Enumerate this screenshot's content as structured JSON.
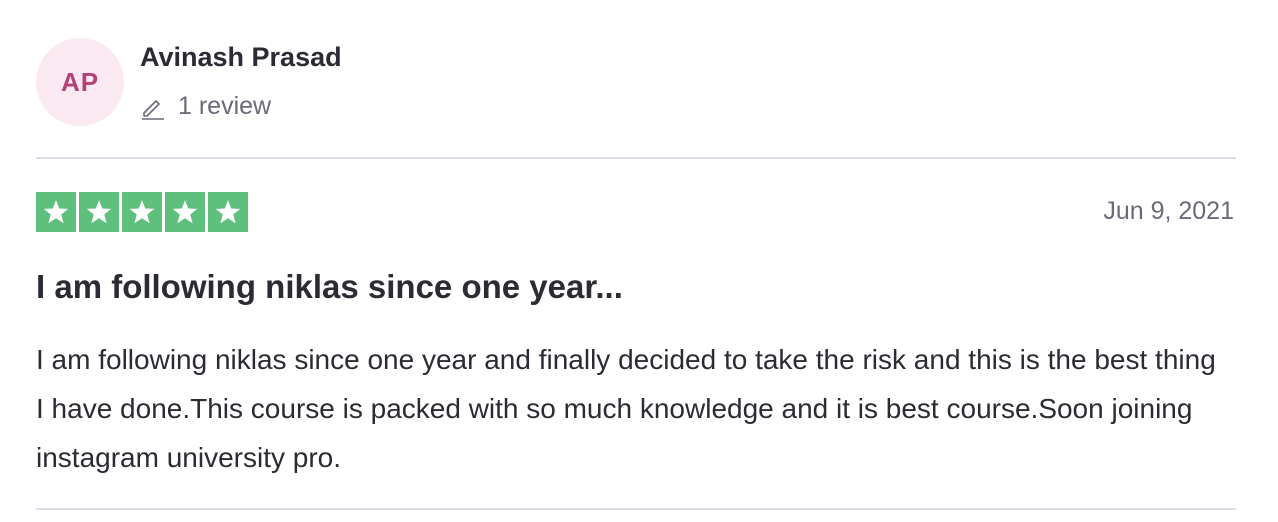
{
  "reviewer": {
    "initials": "AP",
    "name": "Avinash Prasad",
    "review_count": "1 review",
    "avatar_bg": "#fbe9f1",
    "avatar_fg": "#b3427a"
  },
  "review": {
    "rating": 5,
    "star_color": "#5fc07d",
    "date": "Jun 9, 2021",
    "title": "I am following niklas since one year...",
    "text": "I am following niklas since one year and finally decided to take the risk and this is the best thing I have done.This course is packed with so much knowledge and it is best course.Soon joining instagram university pro."
  }
}
